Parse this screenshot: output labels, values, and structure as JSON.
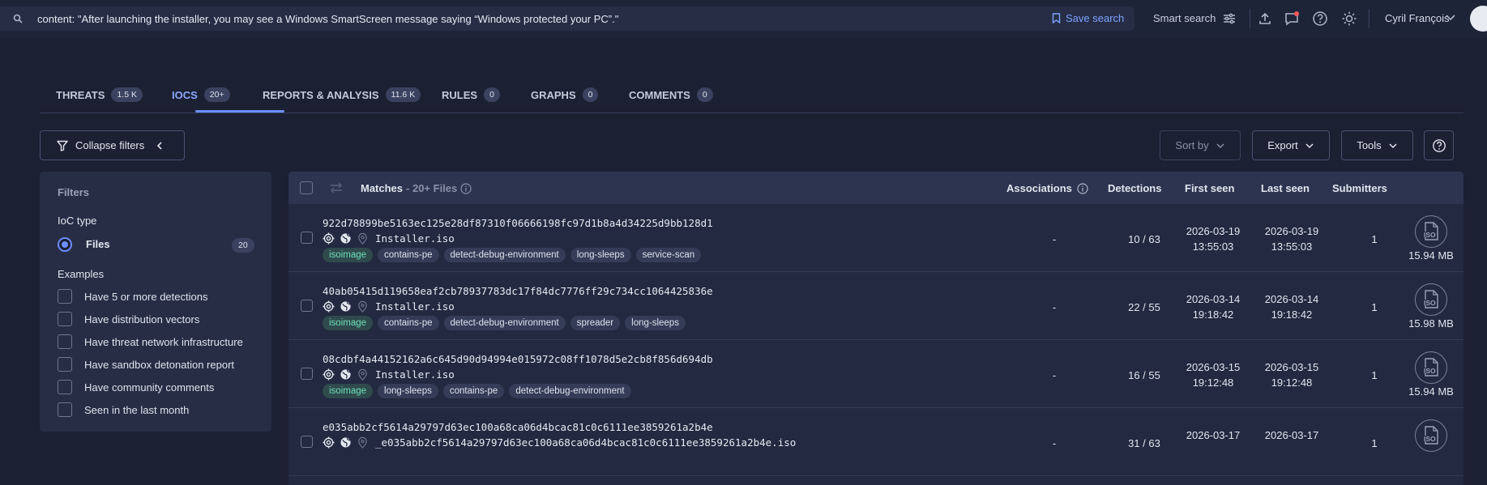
{
  "search": {
    "query": "content: \"After launching the installer, you may see a Windows SmartScreen message saying “Windows protected your PC”.\"",
    "save_label": "Save search"
  },
  "top_nav": {
    "smart_search_label": "Smart search",
    "user_name": "Cyril François"
  },
  "tabs": [
    {
      "label": "THREATS",
      "count": "1.5 K"
    },
    {
      "label": "IOCS",
      "count": "20+",
      "active": true
    },
    {
      "label": "REPORTS & ANALYSIS",
      "count": "11.6 K"
    },
    {
      "label": "RULES",
      "count": "0"
    },
    {
      "label": "GRAPHS",
      "count": "0"
    },
    {
      "label": "COMMENTS",
      "count": "0"
    }
  ],
  "toolbar": {
    "collapse_filters": "Collapse filters",
    "sort_by": "Sort by",
    "export": "Export",
    "tools": "Tools"
  },
  "filters": {
    "title": "Filters",
    "ioc_type_label": "IoC type",
    "files_label": "Files",
    "files_count": "20",
    "examples_label": "Examples",
    "examples": [
      "Have 5 or more detections",
      "Have distribution vectors",
      "Have threat network infrastructure",
      "Have sandbox detonation report",
      "Have community comments",
      "Seen in the last month"
    ]
  },
  "results": {
    "matches_label": "Matches",
    "matches_sub": "- 20+ Files",
    "columns": {
      "associations": "Associations",
      "detections": "Detections",
      "first_seen": "First seen",
      "last_seen": "Last seen",
      "submitters": "Submitters"
    },
    "rows": [
      {
        "hash": "922d78899be5163ec125e28df87310f06666198fc97d1b8a4d34225d9bb128d1",
        "file_name": "Installer.iso",
        "tags": [
          "isoimage",
          "contains-pe",
          "detect-debug-environment",
          "long-sleeps",
          "service-scan"
        ],
        "associations": "-",
        "detections": "10 / 63",
        "first_seen_date": "2026-03-19",
        "first_seen_time": "13:55:03",
        "last_seen_date": "2026-03-19",
        "last_seen_time": "13:55:03",
        "submitters": "1",
        "size": "15.94 MB"
      },
      {
        "hash": "40ab05415d119658eaf2cb78937783dc17f84dc7776ff29c734cc1064425836e",
        "file_name": "Installer.iso",
        "tags": [
          "isoimage",
          "contains-pe",
          "detect-debug-environment",
          "spreader",
          "long-sleeps"
        ],
        "associations": "-",
        "detections": "22 / 55",
        "first_seen_date": "2026-03-14",
        "first_seen_time": "19:18:42",
        "last_seen_date": "2026-03-14",
        "last_seen_time": "19:18:42",
        "submitters": "1",
        "size": "15.98 MB"
      },
      {
        "hash": "08cdbf4a44152162a6c645d90d94994e015972c08ff1078d5e2cb8f856d694db",
        "file_name": "Installer.iso",
        "tags": [
          "isoimage",
          "long-sleeps",
          "contains-pe",
          "detect-debug-environment"
        ],
        "associations": "-",
        "detections": "16 / 55",
        "first_seen_date": "2026-03-15",
        "first_seen_time": "19:12:48",
        "last_seen_date": "2026-03-15",
        "last_seen_time": "19:12:48",
        "submitters": "1",
        "size": "15.94 MB"
      },
      {
        "hash": "e035abb2cf5614a29797d63ec100a68ca06d4bcac81c0c6111ee3859261a2b4e",
        "file_name": "_e035abb2cf5614a29797d63ec100a68ca06d4bcac81c0c6111ee3859261a2b4e.iso",
        "tags": [],
        "associations": "-",
        "detections": "31 / 63",
        "first_seen_date": "2026-03-17",
        "first_seen_time": "",
        "last_seen_date": "2026-03-17",
        "last_seen_time": "",
        "submitters": "1",
        "size": ""
      }
    ]
  },
  "colors": {
    "background": "#1b2032",
    "panel": "#262d45",
    "accent": "#6d8eff",
    "tag_highlight": "#6ee0b7"
  }
}
